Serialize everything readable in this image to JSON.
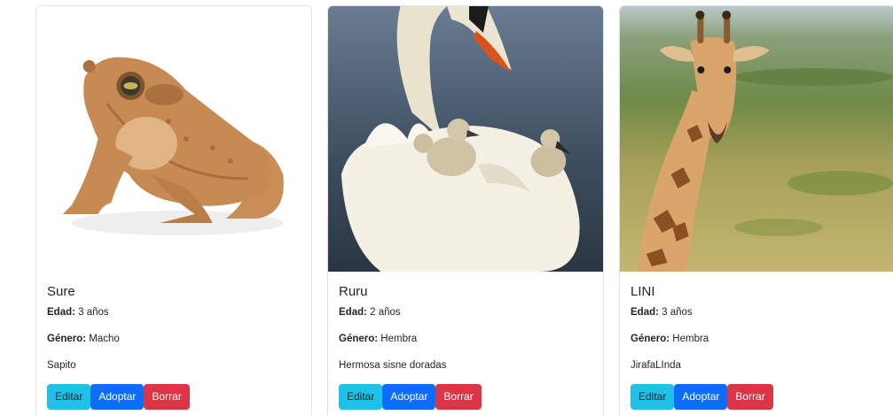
{
  "labels": {
    "age_label": "Edad:",
    "gender_label": "Género:",
    "age_suffix": "años"
  },
  "buttons": {
    "edit": "Editar",
    "adopt": "Adoptar",
    "delete": "Borrar"
  },
  "cards": [
    {
      "name": "Sure",
      "age": "3 años",
      "gender": "Macho",
      "description": "Sapito",
      "image": "toad-photo"
    },
    {
      "name": "Ruru",
      "age": "2 años",
      "gender": "Hembra",
      "description": "Hermosa sisne doradas",
      "image": "swan-photo"
    },
    {
      "name": "LINI",
      "age": "3 años",
      "gender": "Hembra",
      "description": "JirafaLInda",
      "image": "giraffe-photo"
    }
  ],
  "colors": {
    "edit_button": "#1ec2e9",
    "adopt_button": "#0d6efd",
    "delete_button": "#dc3545",
    "card_border": "#dee2e6"
  }
}
